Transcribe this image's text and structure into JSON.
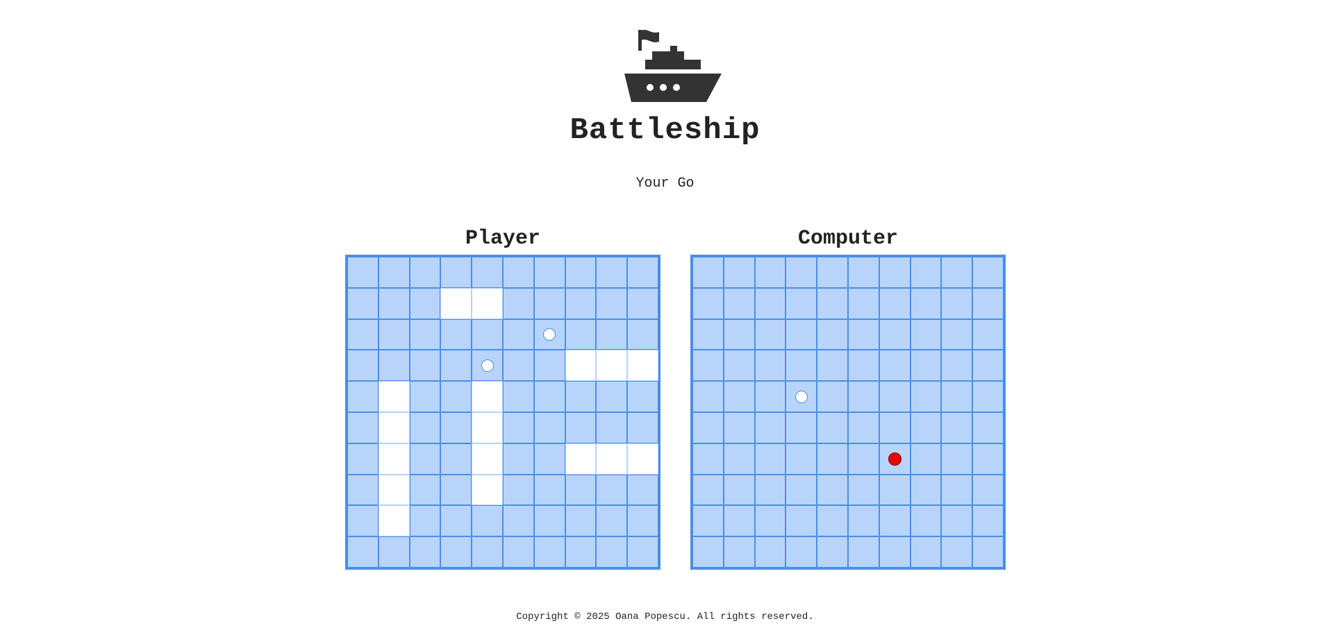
{
  "header": {
    "logo_icon": "battleship-icon",
    "title": "Battleship"
  },
  "status": "Your Go",
  "colors": {
    "water": "#b8d4fb",
    "grid": "#4a8ee6",
    "ship": "#ffffff",
    "hit": "#e8000b",
    "text": "#222222"
  },
  "boards": [
    {
      "id": "player",
      "title": "Player",
      "size": 10,
      "ships": [
        [
          1,
          3
        ],
        [
          1,
          4
        ],
        [
          3,
          7
        ],
        [
          3,
          8
        ],
        [
          3,
          9
        ],
        [
          4,
          1
        ],
        [
          5,
          1
        ],
        [
          6,
          1
        ],
        [
          7,
          1
        ],
        [
          8,
          1
        ],
        [
          4,
          4
        ],
        [
          5,
          4
        ],
        [
          6,
          4
        ],
        [
          7,
          4
        ],
        [
          6,
          7
        ],
        [
          6,
          8
        ],
        [
          6,
          9
        ]
      ],
      "misses": [
        [
          2,
          6
        ],
        [
          3,
          4
        ]
      ],
      "hits": []
    },
    {
      "id": "computer",
      "title": "Computer",
      "size": 10,
      "ships": [],
      "misses": [
        [
          4,
          3
        ]
      ],
      "hits": [
        [
          6,
          6
        ]
      ]
    }
  ],
  "footer": "Copyright © 2025 Oana Popescu. All rights reserved."
}
